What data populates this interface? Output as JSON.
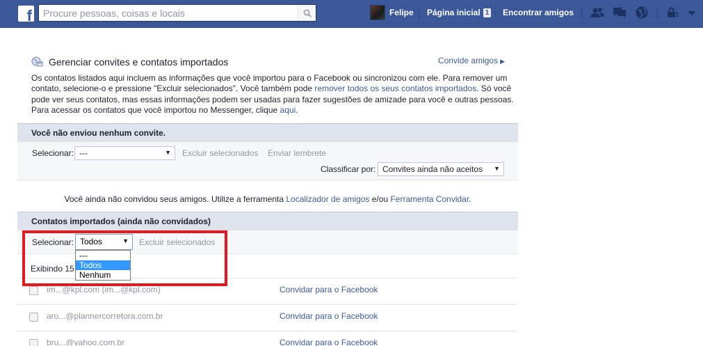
{
  "topbar": {
    "logo": "f",
    "search_placeholder": "Procure pessoas, coisas e locais",
    "user_name": "Felipe",
    "home_label": "Página inicial",
    "home_badge": "1",
    "find_friends_label": "Encontrar amigos",
    "icons": [
      "friends-icon",
      "messages-icon",
      "globe-icon",
      "lock-icon",
      "settings-arrow-icon"
    ]
  },
  "page": {
    "title": "Gerenciar convites e contatos importados",
    "invite_friends_link": "Convide amigos",
    "intro_parts": {
      "p1": "Os contatos listados aqui incluem as informações que você importou para o Facebook ou sincronizou com ele. Para remover um contato, selecione-o e pressione \"Excluir selecionados\". Você também pode ",
      "link1": "remover todos os seus contatos importados",
      "p2": ". Só você pode ver seus contatos, mas essas informações podem ser usadas para fazer sugestões de amizade para você e outras pessoas. Para acessar os contatos que você importou no Messenger, clique ",
      "link2": "aqui",
      "p3": "."
    }
  },
  "invites_section": {
    "header": "Você não enviou nenhum convite.",
    "select_label": "Selecionar:",
    "select_value": "---",
    "delete_selected": "Excluir selecionados",
    "send_reminder": "Enviar lembrete",
    "sort_label": "Classificar por:",
    "sort_value": "Convites ainda não aceitos",
    "empty_msg_pre": "Você ainda não convidou seus amigos. Utilize a ferramenta ",
    "empty_link1": "Localizador de amigos",
    "empty_msg_mid": " e/ou ",
    "empty_link2": "Ferramenta Convidar",
    "empty_msg_post": "."
  },
  "imported_section": {
    "header": "Contatos importados (ainda não convidados)",
    "select_label": "Selecionar:",
    "select_value": "Todos",
    "delete_selected": "Excluir selecionados",
    "dropdown_options": [
      "---",
      "Todos",
      "Nenhum"
    ],
    "dropdown_selected_index": 1,
    "showing_text": "Exibindo 15",
    "contacts": [
      {
        "email": "im...@kpl.com",
        "email2": "im...@kpl.com",
        "action": "Convidar para o Facebook"
      },
      {
        "email": "aro...@plannercorretora.com.br",
        "action": "Convidar para o Facebook"
      },
      {
        "email": "bru...@yahoo.com.br",
        "action": "Convidar para o Facebook"
      }
    ]
  },
  "colors": {
    "brand": "#3b5998",
    "highlight_box": "#e8161a",
    "dropdown_selected": "#3399ff"
  }
}
